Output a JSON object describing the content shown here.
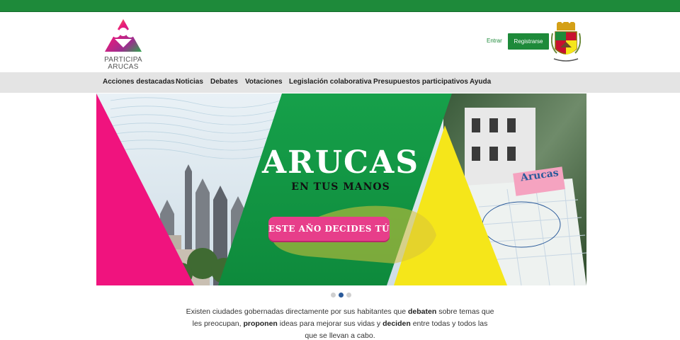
{
  "header": {
    "logo_line1": "PARTICIPA",
    "logo_line2": "ARUCAS",
    "signin_label": "Entrar",
    "register_label": "Registrarse",
    "crest_icon": "coat-of-arms-icon"
  },
  "nav": {
    "items": [
      "Acciones destacadas",
      "Noticias",
      "Debates",
      "Votaciones",
      "Legislación colaborativa",
      "Presupuestos participativos",
      "Ayuda"
    ]
  },
  "hero": {
    "title": "ARUCAS",
    "subtitle": "EN TUS MANOS",
    "cta_label": "ESTE AÑO DECIDES TÚ",
    "map_title": "Arucas",
    "slide_count": 3,
    "active_slide": 2
  },
  "intro": {
    "t1": "Existen ciudades gobernadas directamente por sus habitantes que ",
    "b1": "debaten",
    "t2": " sobre temas que les preocupan, ",
    "b2": "proponen",
    "t3": " ideas para mejorar sus vidas y ",
    "b3": "deciden",
    "t4": " entre todas y todos las que se llevan a cabo."
  },
  "colors": {
    "brand_green": "#1e8a3a",
    "hero_magenta": "#f0137e",
    "hero_yellow": "#f5e61a",
    "cta_pink": "#e73e8a",
    "nav_bg": "#e4e4e4"
  }
}
